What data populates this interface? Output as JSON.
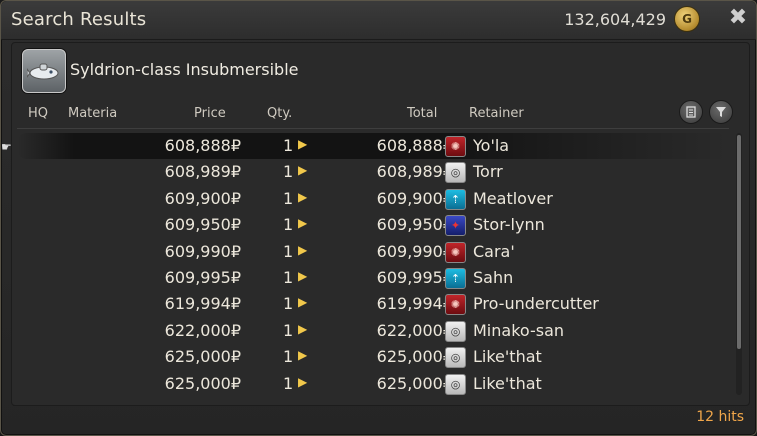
{
  "window": {
    "title": "Search Results",
    "gil_amount": "132,604,429",
    "coin_glyph": "G",
    "close_glyph": "✖"
  },
  "item": {
    "name": "Syldrion-class Insubmersible",
    "icon": "submarine-icon"
  },
  "columns": {
    "hq": "HQ",
    "materia": "Materia",
    "price": "Price",
    "qty": "Qty.",
    "total": "Total",
    "retainer": "Retainer"
  },
  "header_buttons": {
    "history_icon": "history-icon",
    "filter_icon": "filter-icon"
  },
  "listings": [
    {
      "price": "608,888₽",
      "qty": "1",
      "total": "608,888₽",
      "city": "uldah",
      "retainer": "Yo'la",
      "selected": true
    },
    {
      "price": "608,989₽",
      "qty": "1",
      "total": "608,989₽",
      "city": "limsa",
      "retainer": "Torr"
    },
    {
      "price": "609,900₽",
      "qty": "1",
      "total": "609,900₽",
      "city": "gridania",
      "retainer": "Meatlover"
    },
    {
      "price": "609,950₽",
      "qty": "1",
      "total": "609,950₽",
      "city": "ishgard",
      "retainer": "Stor-lynn"
    },
    {
      "price": "609,990₽",
      "qty": "1",
      "total": "609,990₽",
      "city": "uldah",
      "retainer": "Cara'"
    },
    {
      "price": "609,995₽",
      "qty": "1",
      "total": "609,995₽",
      "city": "gridania",
      "retainer": "Sahn"
    },
    {
      "price": "619,994₽",
      "qty": "1",
      "total": "619,994₽",
      "city": "uldah",
      "retainer": "Pro-undercutter"
    },
    {
      "price": "622,000₽",
      "qty": "1",
      "total": "622,000₽",
      "city": "limsa",
      "retainer": "Minako-san"
    },
    {
      "price": "625,000₽",
      "qty": "1",
      "total": "625,000₽",
      "city": "limsa",
      "retainer": "Like'that"
    },
    {
      "price": "625,000₽",
      "qty": "1",
      "total": "625,000₽",
      "city": "limsa",
      "retainer": "Like'that"
    }
  ],
  "city_icons": {
    "uldah": "uldah-crest-icon",
    "limsa": "limsa-crest-icon",
    "gridania": "gridania-crest-icon",
    "ishgard": "ishgard-crest-icon"
  },
  "footer": {
    "hits": "12 hits"
  },
  "colors": {
    "hits": "#f0a64a",
    "arrow": "#f1c84b"
  }
}
